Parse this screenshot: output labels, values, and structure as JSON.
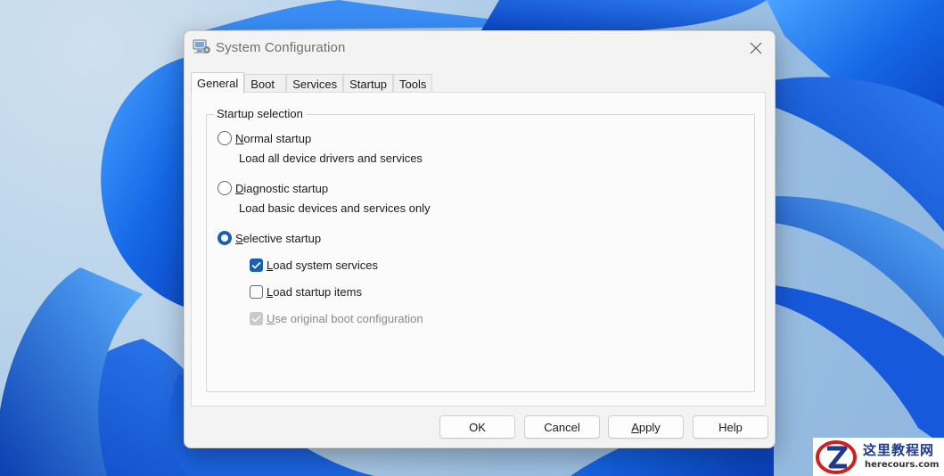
{
  "window": {
    "title": "System Configuration"
  },
  "tabs": [
    {
      "label": "General",
      "active": true
    },
    {
      "label": "Boot",
      "active": false
    },
    {
      "label": "Services",
      "active": false
    },
    {
      "label": "Startup",
      "active": false
    },
    {
      "label": "Tools",
      "active": false
    }
  ],
  "general": {
    "group_label": "Startup selection",
    "normal": {
      "hotkey": "N",
      "label_rest": "ormal startup",
      "description": "Load all device drivers and services",
      "selected": false
    },
    "diagnostic": {
      "hotkey": "D",
      "label_rest": "iagnostic startup",
      "description": "Load basic devices and services only",
      "selected": false
    },
    "selective": {
      "hotkey": "S",
      "label_rest": "elective startup",
      "selected": true,
      "options": {
        "load_system_services": {
          "hotkey": "L",
          "label_rest": "oad system services",
          "checked": true,
          "disabled": false
        },
        "load_startup_items": {
          "hotkey": "L",
          "label_rest": "oad startup items",
          "checked": false,
          "disabled": false
        },
        "use_original_boot": {
          "hotkey": "U",
          "label_rest": "se original boot configuration",
          "checked": true,
          "disabled": true
        }
      }
    }
  },
  "buttons": {
    "ok": "OK",
    "cancel": "Cancel",
    "apply_hotkey": "A",
    "apply_rest": "pply",
    "help": "Help"
  },
  "watermark": {
    "title": "这里教程网",
    "url": "herecours.com"
  },
  "colors": {
    "accent": "#1a5fb4",
    "window_bg": "#f3f3f3",
    "panel_bg": "#fbfbfb"
  }
}
